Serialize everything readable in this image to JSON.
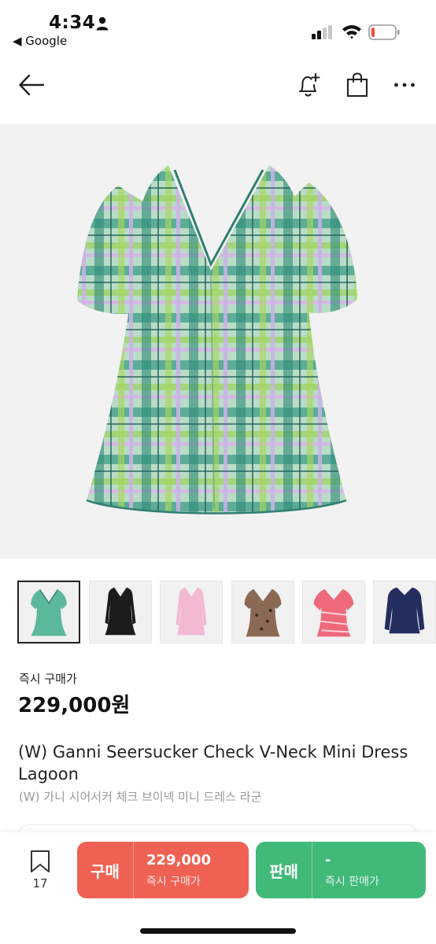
{
  "status_bar": {
    "time": "4:34",
    "back_app": "◀ Google"
  },
  "nav": {
    "back_icon": "arrow-left-icon",
    "alert_icon": "bell-plus-icon",
    "cart_icon": "shopping-bag-icon",
    "more_icon": "more-dots-icon"
  },
  "thumbnails": [
    {
      "name": "plaid-dress",
      "color": "#5cb89a",
      "active": true
    },
    {
      "name": "black-dress",
      "color": "#1c1c1c",
      "active": false
    },
    {
      "name": "pink-dress",
      "color": "#f3b8d2",
      "active": false
    },
    {
      "name": "leopard-dress",
      "color": "#8a6a54",
      "active": false
    },
    {
      "name": "zebra-pink-dress",
      "color": "#ee6a7a",
      "active": false
    },
    {
      "name": "navy-dress",
      "color": "#232d5e",
      "active": false
    }
  ],
  "product": {
    "price_label": "즉시 구매가",
    "price": "229,000원",
    "title": "(W) Ganni Seersucker Check V-Neck Mini Dress Lagoon",
    "subtitle": "(W) 가니 시어서커 체크 브이넥 미니 드레스 라군"
  },
  "bottom_bar": {
    "bookmark_count": "17",
    "buy": {
      "label": "구매",
      "value": "229,000",
      "sub": "즉시 구매가",
      "color": "#ef6253"
    },
    "sell": {
      "label": "판매",
      "value": "-",
      "sub": "즉시 판매가",
      "color": "#41b979"
    }
  }
}
